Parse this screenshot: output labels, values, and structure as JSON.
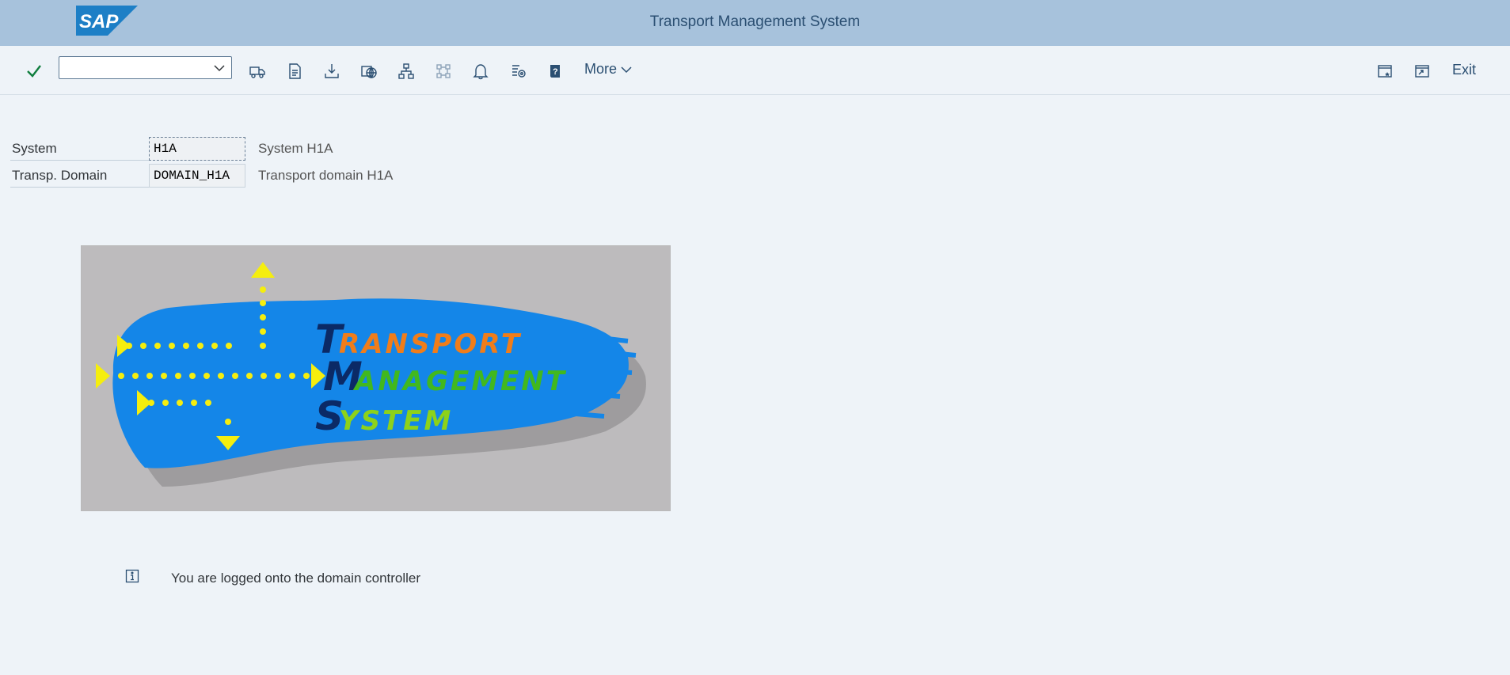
{
  "header": {
    "logo_text": "SAP",
    "title": "Transport Management System",
    "brand_color": "#1d7fc6"
  },
  "toolbar": {
    "enter_icon": "checkmark-icon",
    "command_field": {
      "value": "",
      "placeholder": ""
    },
    "buttons": [
      {
        "icon": "truck-icon"
      },
      {
        "icon": "document-icon"
      },
      {
        "icon": "import-icon"
      },
      {
        "icon": "globe-icon"
      },
      {
        "icon": "hierarchy-icon"
      },
      {
        "icon": "network-icon"
      },
      {
        "icon": "bell-icon"
      },
      {
        "icon": "list-settings-icon"
      },
      {
        "icon": "help-book-icon"
      }
    ],
    "more_label": "More",
    "exit_label": "Exit",
    "right_icons": [
      "new-window-icon",
      "window-arrow-icon"
    ]
  },
  "form": {
    "fields": [
      {
        "label": "System",
        "value": "H1A",
        "description": "System H1A"
      },
      {
        "label": "Transp. Domain",
        "value": "DOMAIN_H1A",
        "description": "Transport domain H1A"
      }
    ]
  },
  "banner": {
    "line1_initial": "T",
    "line1_rest": "RANSPORT",
    "line2_initial": "M",
    "line2_rest": "ANAGEMENT",
    "line3_initial": "S",
    "line3_rest": "YSTEM"
  },
  "status": {
    "icon": "info-icon",
    "message": "You are logged onto the domain controller"
  }
}
